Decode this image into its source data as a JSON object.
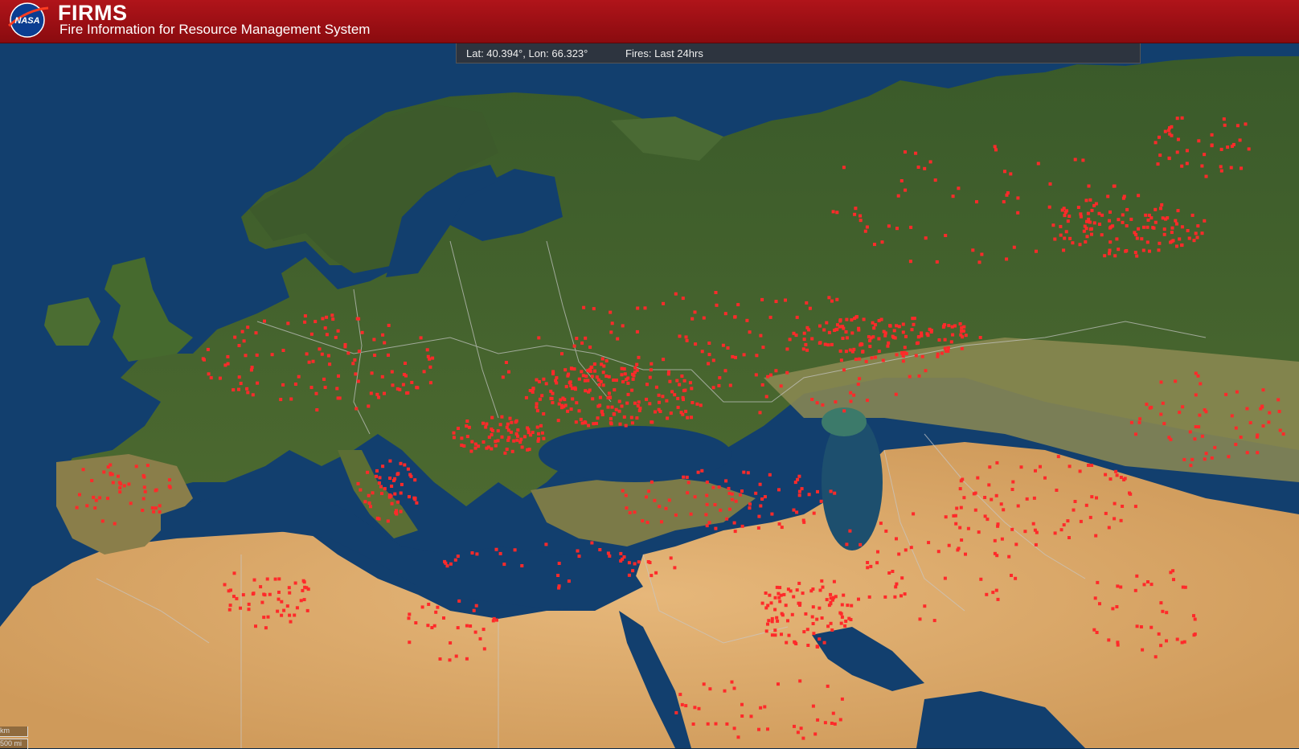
{
  "header": {
    "logo_text": "NASA",
    "title": "FIRMS",
    "subtitle": "Fire Information for Resource Management System",
    "background": "#a50f14"
  },
  "infobar": {
    "coordinates": "Lat: 40.394°, Lon: 66.323°",
    "fires_label": "Fires: Last 24hrs"
  },
  "scale": {
    "km_label": "km",
    "mi_label": "500 mi"
  },
  "map": {
    "ocean_color": "#123f6e",
    "vegetation_color": "#3f5e2a",
    "desert_color": "#d9a967",
    "fire_color": "#ff2a2a",
    "border_color": "#c8c8c8"
  }
}
